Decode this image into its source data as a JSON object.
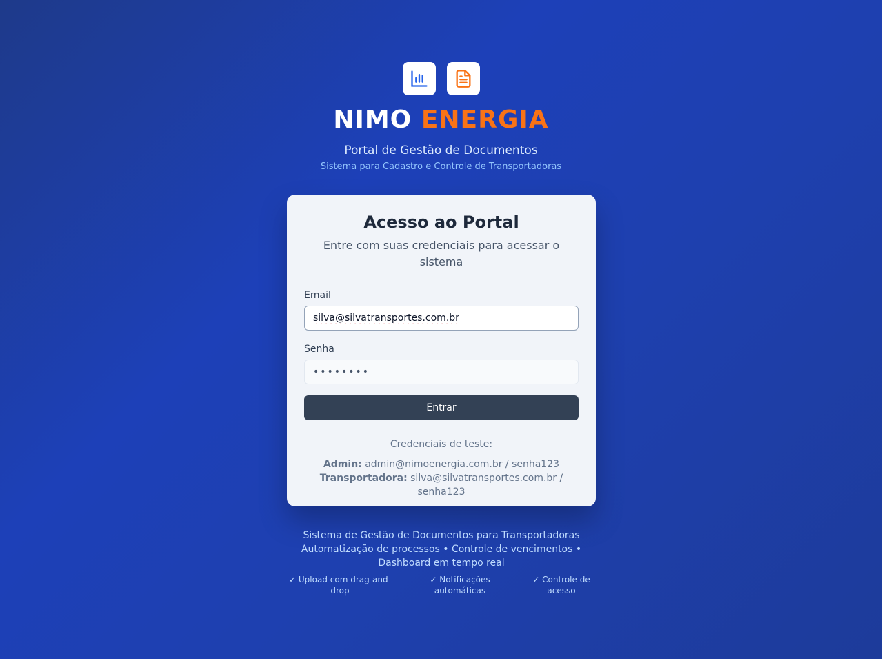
{
  "brand": {
    "name_part1": "NIMO",
    "name_part2": "ENERGIA",
    "subtitle": "Portal de Gestão de Documentos",
    "tagline": "Sistema para Cadastro e Controle de Transportadoras",
    "icons": [
      "bar-chart-icon",
      "document-icon"
    ],
    "accent_color": "#f97316"
  },
  "login": {
    "title": "Acesso ao Portal",
    "description": "Entre com suas credenciais para acessar o sistema",
    "email_label": "Email",
    "email_value": "silva@silvatransportes.com.br",
    "password_label": "Senha",
    "password_value": "••••••••",
    "submit_label": "Entrar"
  },
  "test_credentials": {
    "title": "Credenciais de teste:",
    "admin_label": "Admin:",
    "admin_value": "admin@nimoenergia.com.br / senha123",
    "carrier_label": "Transportadora:",
    "carrier_value": "silva@silvatransportes.com.br / senha123"
  },
  "footer": {
    "line1": "Sistema de Gestão de Documentos para Transportadoras",
    "line2": "Automatização de processos • Controle de vencimentos • Dashboard em tempo real",
    "features": [
      "✓ Upload com drag-and-drop",
      "✓ Notificações automáticas",
      "✓ Controle de acesso"
    ]
  }
}
